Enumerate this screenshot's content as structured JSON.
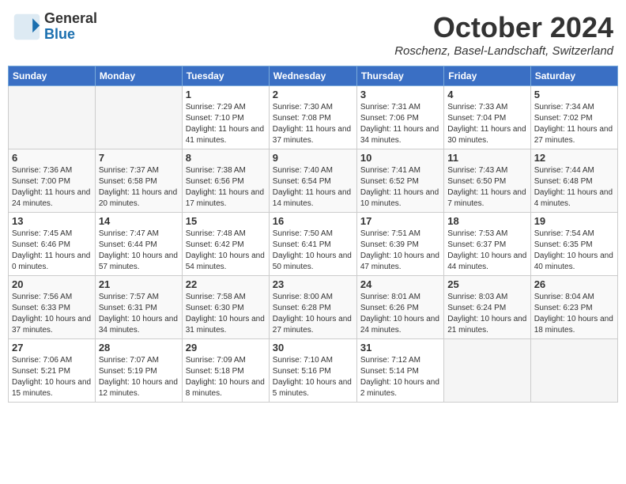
{
  "logo": {
    "general": "General",
    "blue": "Blue"
  },
  "title": "October 2024",
  "location": "Roschenz, Basel-Landschaft, Switzerland",
  "days_of_week": [
    "Sunday",
    "Monday",
    "Tuesday",
    "Wednesday",
    "Thursday",
    "Friday",
    "Saturday"
  ],
  "weeks": [
    [
      {
        "num": "",
        "empty": true
      },
      {
        "num": "",
        "empty": true
      },
      {
        "num": "1",
        "sunrise": "7:29 AM",
        "sunset": "7:10 PM",
        "daylight": "11 hours and 41 minutes."
      },
      {
        "num": "2",
        "sunrise": "7:30 AM",
        "sunset": "7:08 PM",
        "daylight": "11 hours and 37 minutes."
      },
      {
        "num": "3",
        "sunrise": "7:31 AM",
        "sunset": "7:06 PM",
        "daylight": "11 hours and 34 minutes."
      },
      {
        "num": "4",
        "sunrise": "7:33 AM",
        "sunset": "7:04 PM",
        "daylight": "11 hours and 30 minutes."
      },
      {
        "num": "5",
        "sunrise": "7:34 AM",
        "sunset": "7:02 PM",
        "daylight": "11 hours and 27 minutes."
      }
    ],
    [
      {
        "num": "6",
        "sunrise": "7:36 AM",
        "sunset": "7:00 PM",
        "daylight": "11 hours and 24 minutes."
      },
      {
        "num": "7",
        "sunrise": "7:37 AM",
        "sunset": "6:58 PM",
        "daylight": "11 hours and 20 minutes."
      },
      {
        "num": "8",
        "sunrise": "7:38 AM",
        "sunset": "6:56 PM",
        "daylight": "11 hours and 17 minutes."
      },
      {
        "num": "9",
        "sunrise": "7:40 AM",
        "sunset": "6:54 PM",
        "daylight": "11 hours and 14 minutes."
      },
      {
        "num": "10",
        "sunrise": "7:41 AM",
        "sunset": "6:52 PM",
        "daylight": "11 hours and 10 minutes."
      },
      {
        "num": "11",
        "sunrise": "7:43 AM",
        "sunset": "6:50 PM",
        "daylight": "11 hours and 7 minutes."
      },
      {
        "num": "12",
        "sunrise": "7:44 AM",
        "sunset": "6:48 PM",
        "daylight": "11 hours and 4 minutes."
      }
    ],
    [
      {
        "num": "13",
        "sunrise": "7:45 AM",
        "sunset": "6:46 PM",
        "daylight": "11 hours and 0 minutes."
      },
      {
        "num": "14",
        "sunrise": "7:47 AM",
        "sunset": "6:44 PM",
        "daylight": "10 hours and 57 minutes."
      },
      {
        "num": "15",
        "sunrise": "7:48 AM",
        "sunset": "6:42 PM",
        "daylight": "10 hours and 54 minutes."
      },
      {
        "num": "16",
        "sunrise": "7:50 AM",
        "sunset": "6:41 PM",
        "daylight": "10 hours and 50 minutes."
      },
      {
        "num": "17",
        "sunrise": "7:51 AM",
        "sunset": "6:39 PM",
        "daylight": "10 hours and 47 minutes."
      },
      {
        "num": "18",
        "sunrise": "7:53 AM",
        "sunset": "6:37 PM",
        "daylight": "10 hours and 44 minutes."
      },
      {
        "num": "19",
        "sunrise": "7:54 AM",
        "sunset": "6:35 PM",
        "daylight": "10 hours and 40 minutes."
      }
    ],
    [
      {
        "num": "20",
        "sunrise": "7:56 AM",
        "sunset": "6:33 PM",
        "daylight": "10 hours and 37 minutes."
      },
      {
        "num": "21",
        "sunrise": "7:57 AM",
        "sunset": "6:31 PM",
        "daylight": "10 hours and 34 minutes."
      },
      {
        "num": "22",
        "sunrise": "7:58 AM",
        "sunset": "6:30 PM",
        "daylight": "10 hours and 31 minutes."
      },
      {
        "num": "23",
        "sunrise": "8:00 AM",
        "sunset": "6:28 PM",
        "daylight": "10 hours and 27 minutes."
      },
      {
        "num": "24",
        "sunrise": "8:01 AM",
        "sunset": "6:26 PM",
        "daylight": "10 hours and 24 minutes."
      },
      {
        "num": "25",
        "sunrise": "8:03 AM",
        "sunset": "6:24 PM",
        "daylight": "10 hours and 21 minutes."
      },
      {
        "num": "26",
        "sunrise": "8:04 AM",
        "sunset": "6:23 PM",
        "daylight": "10 hours and 18 minutes."
      }
    ],
    [
      {
        "num": "27",
        "sunrise": "7:06 AM",
        "sunset": "5:21 PM",
        "daylight": "10 hours and 15 minutes."
      },
      {
        "num": "28",
        "sunrise": "7:07 AM",
        "sunset": "5:19 PM",
        "daylight": "10 hours and 12 minutes."
      },
      {
        "num": "29",
        "sunrise": "7:09 AM",
        "sunset": "5:18 PM",
        "daylight": "10 hours and 8 minutes."
      },
      {
        "num": "30",
        "sunrise": "7:10 AM",
        "sunset": "5:16 PM",
        "daylight": "10 hours and 5 minutes."
      },
      {
        "num": "31",
        "sunrise": "7:12 AM",
        "sunset": "5:14 PM",
        "daylight": "10 hours and 2 minutes."
      },
      {
        "num": "",
        "empty": true
      },
      {
        "num": "",
        "empty": true
      }
    ]
  ]
}
